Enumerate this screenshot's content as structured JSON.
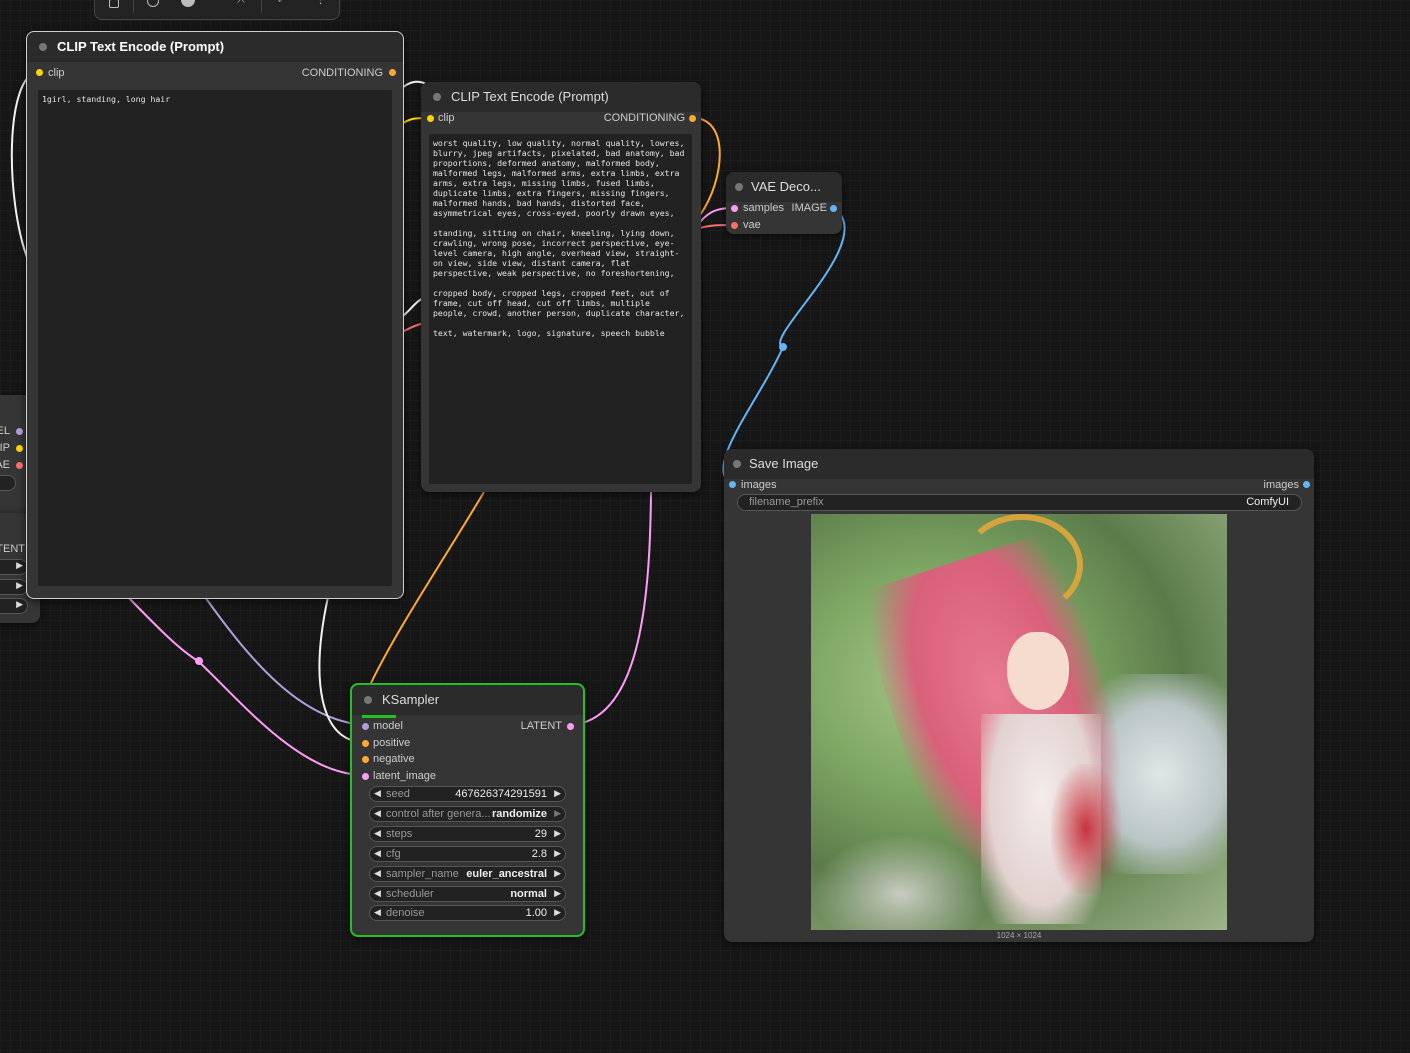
{
  "toolbar": {
    "icons": [
      "lock-icon",
      "circle-icon",
      "color-dot-icon",
      "crop-icon",
      "pin-icon",
      "more-icon"
    ]
  },
  "colors": {
    "model": "#b39ddb",
    "clip": "#ffd500",
    "vae": "#ff6e6e",
    "conditioning": "#ffa931",
    "latent": "#ff9cf9",
    "image": "#64b5f6",
    "white_link": "#f0f0f0",
    "selected_border": "#22c122"
  },
  "left_partial": {
    "outputs": [
      "EL",
      "LIP",
      "AE"
    ],
    "latent_label": "TENT"
  },
  "clip_positive": {
    "title": "CLIP Text Encode (Prompt)",
    "input_label": "clip",
    "output_label": "CONDITIONING",
    "text": "1girl, standing, long hair"
  },
  "clip_negative": {
    "title": "CLIP Text Encode (Prompt)",
    "input_label": "clip",
    "output_label": "CONDITIONING",
    "text": "worst quality, low quality, normal quality, lowres, blurry, jpeg artifacts, pixelated, bad anatomy, bad proportions, deformed anatomy, malformed body, malformed legs, malformed arms, extra limbs, extra arms, extra legs, missing limbs, fused limbs, duplicate limbs, extra fingers, missing fingers, malformed hands, bad hands, distorted face, asymmetrical eyes, cross-eyed, poorly drawn eyes,\n\nstanding, sitting on chair, kneeling, lying down, crawling, wrong pose, incorrect perspective, eye-level camera, high angle, overhead view, straight-on view, side view, distant camera, flat perspective, weak perspective, no foreshortening,\n\ncropped body, cropped legs, cropped feet, out of frame, cut off head, cut off limbs, multiple people, crowd, another person, duplicate character,\n\ntext, watermark, logo, signature, speech bubble"
  },
  "vae_decode": {
    "title": "VAE Deco...",
    "inputs": [
      "samples",
      "vae"
    ],
    "output_label": "IMAGE"
  },
  "save_image": {
    "title": "Save Image",
    "input_label": "images",
    "output_label": "images",
    "filename_prefix_label": "filename_prefix",
    "filename_prefix_value": "ComfyUI",
    "image_size": "1024 × 1024"
  },
  "ksampler": {
    "title": "KSampler",
    "inputs": [
      "model",
      "positive",
      "negative",
      "latent_image"
    ],
    "output_label": "LATENT",
    "widgets": [
      {
        "label": "seed",
        "value": "467626374291591"
      },
      {
        "label": "control after genera...",
        "value": "randomize"
      },
      {
        "label": "steps",
        "value": "29"
      },
      {
        "label": "cfg",
        "value": "2.8"
      },
      {
        "label": "sampler_name",
        "value": "euler_ancestral"
      },
      {
        "label": "scheduler",
        "value": "normal"
      },
      {
        "label": "denoise",
        "value": "1.00"
      }
    ]
  }
}
